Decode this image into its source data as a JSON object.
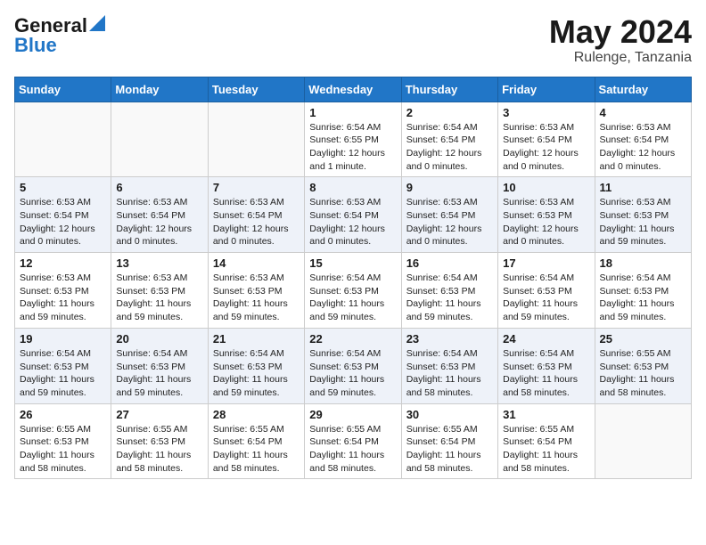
{
  "header": {
    "logo_general": "General",
    "logo_blue": "Blue",
    "title": "May 2024",
    "location": "Rulenge, Tanzania"
  },
  "weekdays": [
    "Sunday",
    "Monday",
    "Tuesday",
    "Wednesday",
    "Thursday",
    "Friday",
    "Saturday"
  ],
  "weeks": [
    [
      {
        "day": "",
        "info": ""
      },
      {
        "day": "",
        "info": ""
      },
      {
        "day": "",
        "info": ""
      },
      {
        "day": "1",
        "info": "Sunrise: 6:54 AM\nSunset: 6:55 PM\nDaylight: 12 hours\nand 1 minute."
      },
      {
        "day": "2",
        "info": "Sunrise: 6:54 AM\nSunset: 6:54 PM\nDaylight: 12 hours\nand 0 minutes."
      },
      {
        "day": "3",
        "info": "Sunrise: 6:53 AM\nSunset: 6:54 PM\nDaylight: 12 hours\nand 0 minutes."
      },
      {
        "day": "4",
        "info": "Sunrise: 6:53 AM\nSunset: 6:54 PM\nDaylight: 12 hours\nand 0 minutes."
      }
    ],
    [
      {
        "day": "5",
        "info": "Sunrise: 6:53 AM\nSunset: 6:54 PM\nDaylight: 12 hours\nand 0 minutes."
      },
      {
        "day": "6",
        "info": "Sunrise: 6:53 AM\nSunset: 6:54 PM\nDaylight: 12 hours\nand 0 minutes."
      },
      {
        "day": "7",
        "info": "Sunrise: 6:53 AM\nSunset: 6:54 PM\nDaylight: 12 hours\nand 0 minutes."
      },
      {
        "day": "8",
        "info": "Sunrise: 6:53 AM\nSunset: 6:54 PM\nDaylight: 12 hours\nand 0 minutes."
      },
      {
        "day": "9",
        "info": "Sunrise: 6:53 AM\nSunset: 6:54 PM\nDaylight: 12 hours\nand 0 minutes."
      },
      {
        "day": "10",
        "info": "Sunrise: 6:53 AM\nSunset: 6:53 PM\nDaylight: 12 hours\nand 0 minutes."
      },
      {
        "day": "11",
        "info": "Sunrise: 6:53 AM\nSunset: 6:53 PM\nDaylight: 11 hours\nand 59 minutes."
      }
    ],
    [
      {
        "day": "12",
        "info": "Sunrise: 6:53 AM\nSunset: 6:53 PM\nDaylight: 11 hours\nand 59 minutes."
      },
      {
        "day": "13",
        "info": "Sunrise: 6:53 AM\nSunset: 6:53 PM\nDaylight: 11 hours\nand 59 minutes."
      },
      {
        "day": "14",
        "info": "Sunrise: 6:53 AM\nSunset: 6:53 PM\nDaylight: 11 hours\nand 59 minutes."
      },
      {
        "day": "15",
        "info": "Sunrise: 6:54 AM\nSunset: 6:53 PM\nDaylight: 11 hours\nand 59 minutes."
      },
      {
        "day": "16",
        "info": "Sunrise: 6:54 AM\nSunset: 6:53 PM\nDaylight: 11 hours\nand 59 minutes."
      },
      {
        "day": "17",
        "info": "Sunrise: 6:54 AM\nSunset: 6:53 PM\nDaylight: 11 hours\nand 59 minutes."
      },
      {
        "day": "18",
        "info": "Sunrise: 6:54 AM\nSunset: 6:53 PM\nDaylight: 11 hours\nand 59 minutes."
      }
    ],
    [
      {
        "day": "19",
        "info": "Sunrise: 6:54 AM\nSunset: 6:53 PM\nDaylight: 11 hours\nand 59 minutes."
      },
      {
        "day": "20",
        "info": "Sunrise: 6:54 AM\nSunset: 6:53 PM\nDaylight: 11 hours\nand 59 minutes."
      },
      {
        "day": "21",
        "info": "Sunrise: 6:54 AM\nSunset: 6:53 PM\nDaylight: 11 hours\nand 59 minutes."
      },
      {
        "day": "22",
        "info": "Sunrise: 6:54 AM\nSunset: 6:53 PM\nDaylight: 11 hours\nand 59 minutes."
      },
      {
        "day": "23",
        "info": "Sunrise: 6:54 AM\nSunset: 6:53 PM\nDaylight: 11 hours\nand 58 minutes."
      },
      {
        "day": "24",
        "info": "Sunrise: 6:54 AM\nSunset: 6:53 PM\nDaylight: 11 hours\nand 58 minutes."
      },
      {
        "day": "25",
        "info": "Sunrise: 6:55 AM\nSunset: 6:53 PM\nDaylight: 11 hours\nand 58 minutes."
      }
    ],
    [
      {
        "day": "26",
        "info": "Sunrise: 6:55 AM\nSunset: 6:53 PM\nDaylight: 11 hours\nand 58 minutes."
      },
      {
        "day": "27",
        "info": "Sunrise: 6:55 AM\nSunset: 6:53 PM\nDaylight: 11 hours\nand 58 minutes."
      },
      {
        "day": "28",
        "info": "Sunrise: 6:55 AM\nSunset: 6:54 PM\nDaylight: 11 hours\nand 58 minutes."
      },
      {
        "day": "29",
        "info": "Sunrise: 6:55 AM\nSunset: 6:54 PM\nDaylight: 11 hours\nand 58 minutes."
      },
      {
        "day": "30",
        "info": "Sunrise: 6:55 AM\nSunset: 6:54 PM\nDaylight: 11 hours\nand 58 minutes."
      },
      {
        "day": "31",
        "info": "Sunrise: 6:55 AM\nSunset: 6:54 PM\nDaylight: 11 hours\nand 58 minutes."
      },
      {
        "day": "",
        "info": ""
      }
    ]
  ]
}
